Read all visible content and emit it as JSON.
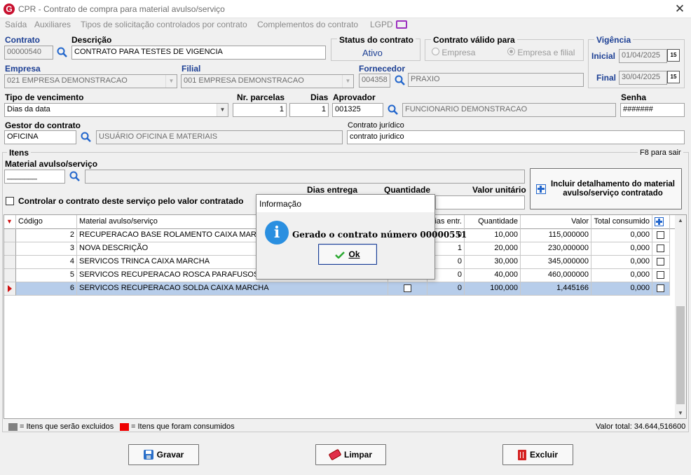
{
  "window": {
    "title": "CPR - Contrato de compra para material avulso/serviço",
    "close_glyph": "✕"
  },
  "menu": [
    "Saída",
    "Auxiliares",
    "Tipos de solicitação controlados por contrato",
    "Complementos do contrato",
    "LGPD"
  ],
  "contrato": {
    "label": "Contrato",
    "value": "00000540"
  },
  "descricao": {
    "label": "Descrição",
    "value": "CONTRATO PARA TESTES DE VIGENCIA"
  },
  "status": {
    "label": "Status do contrato",
    "value": "Ativo"
  },
  "valido_para": {
    "label": "Contrato válido para",
    "options": [
      "Empresa",
      "Empresa e filial"
    ],
    "selected": "Empresa e filial"
  },
  "vigencia": {
    "label": "Vigência",
    "inicial_label": "Inicial",
    "inicial": "01/04/2025",
    "final_label": "Final",
    "final": "30/04/2025",
    "cal_glyph": "15"
  },
  "empresa": {
    "label": "Empresa",
    "value": "021 EMPRESA DEMONSTRACAO"
  },
  "filial": {
    "label": "Filial",
    "value": "001 EMPRESA DEMONSTRACAO"
  },
  "fornecedor": {
    "label": "Fornecedor",
    "code": "004358",
    "name": "PRAXIO"
  },
  "tipo_vencimento": {
    "label": "Tipo de vencimento",
    "value": "Dias da data"
  },
  "nr_parcelas": {
    "label": "Nr. parcelas",
    "value": "1"
  },
  "dias": {
    "label": "Dias",
    "value": "1"
  },
  "aprovador": {
    "label": "Aprovador",
    "code": "001325",
    "name": "FUNCIONARIO DEMONSTRACAO"
  },
  "senha": {
    "label": "Senha",
    "value": "#######"
  },
  "gestor": {
    "label": "Gestor do contrato",
    "code": "OFICINA",
    "name": "USUÁRIO OFICINA E MATERIAIS"
  },
  "juridico": {
    "label": "Contrato jurídico",
    "value": "contrato juridico"
  },
  "itens": {
    "label": "Itens",
    "f8_hint": "F8 para sair",
    "material_label": "Material avulso/serviço",
    "material_code": "_______",
    "controlar_label": "Controlar o contrato deste serviço pelo valor contratado",
    "dias_entrega_label": "Dias entrega",
    "quantidade_label": "Quantidade",
    "valor_unitario_label": "Valor unitário",
    "incluir_button": "Incluir detalhamento do material avulso/serviço contratado"
  },
  "grid": {
    "columns": [
      "Código",
      "Material avulso/serviço",
      "",
      "ias entr.",
      "Quantidade",
      "Valor",
      "Total consumido"
    ],
    "rows": [
      {
        "codigo": "2",
        "material": "RECUPERACAO BASE ROLAMENTO CAIXA MARCHA",
        "dias": "0",
        "quantidade": "10,000",
        "valor": "115,000000",
        "total": "0,000"
      },
      {
        "codigo": "3",
        "material": "NOVA DESCRIÇÃO",
        "dias": "1",
        "quantidade": "20,000",
        "valor": "230,000000",
        "total": "0,000"
      },
      {
        "codigo": "4",
        "material": "SERVICOS TRINCA CAIXA MARCHA",
        "dias": "0",
        "quantidade": "30,000",
        "valor": "345,000000",
        "total": "0,000"
      },
      {
        "codigo": "5",
        "material": "SERVICOS RECUPERACAO ROSCA PARAFUSOS C",
        "dias": "0",
        "quantidade": "40,000",
        "valor": "460,000000",
        "total": "0,000"
      },
      {
        "codigo": "6",
        "material": "SERVICOS RECUPERACAO SOLDA CAIXA MARCHA",
        "dias": "0",
        "quantidade": "100,000",
        "valor": "1,445166",
        "total": "0,000"
      }
    ],
    "selected_row": 4
  },
  "legend": {
    "excluidos": "= Itens que serão excluidos",
    "consumidos": "= Itens que foram consumidos",
    "valor_total": "Valor total: 34.644,516600",
    "colors": {
      "excluidos": "#808080",
      "consumidos": "#ee0000"
    }
  },
  "buttons": {
    "gravar": "Gravar",
    "limpar": "Limpar",
    "excluir": "Excluir"
  },
  "dialog": {
    "title": "Informação",
    "message": "Gerado o contrato número 00000551",
    "ok": "Ok",
    "icon_glyph": "i"
  },
  "colors": {
    "label_blue": "#1c3f94",
    "selection": "#b7cdea",
    "info_blue": "#2a8fe0"
  }
}
